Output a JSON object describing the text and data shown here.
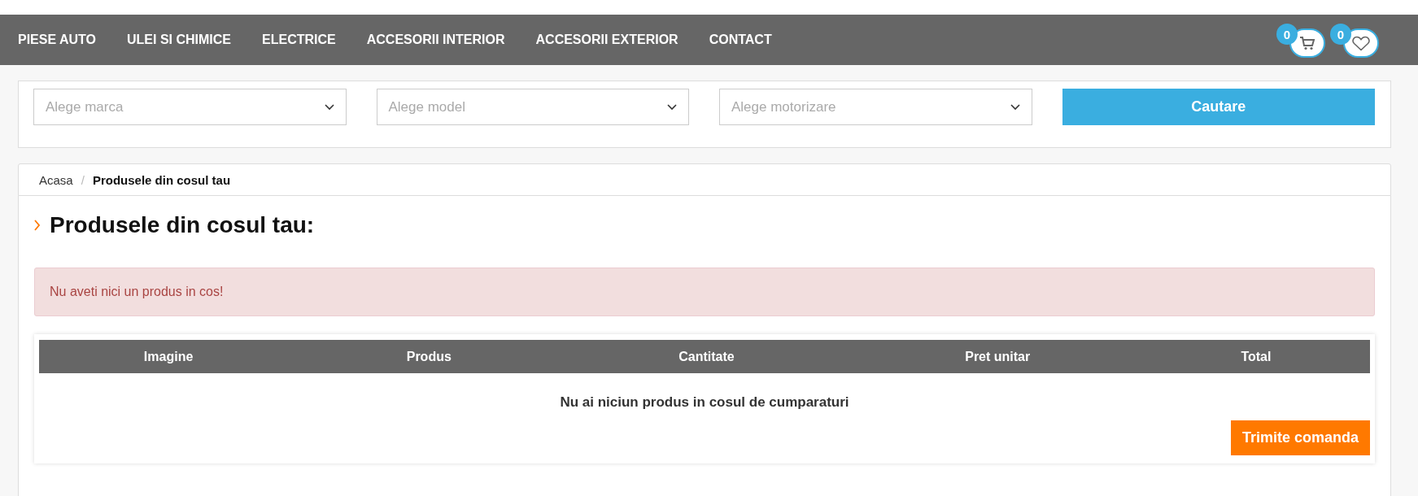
{
  "nav": {
    "items": [
      "PIESE AUTO",
      "ULEI SI CHIMICE",
      "ELECTRICE",
      "ACCESORII INTERIOR",
      "ACCESORII EXTERIOR",
      "CONTACT"
    ],
    "cart_count": "0",
    "wishlist_count": "0"
  },
  "search": {
    "selects": [
      {
        "placeholder": "Alege marca"
      },
      {
        "placeholder": "Alege model"
      },
      {
        "placeholder": "Alege motorizare"
      }
    ],
    "button": "Cautare"
  },
  "breadcrumb": {
    "separator": "/",
    "items": [
      {
        "label": "Acasa",
        "current": false
      },
      {
        "label": "Produsele din cosul tau",
        "current": true
      }
    ]
  },
  "page_title": "Produsele din cosul tau:",
  "alert": "Nu aveti nici un produs in cos!",
  "table": {
    "columns": [
      "Imagine",
      "Produs",
      "Cantitate",
      "Pret unitar",
      "Total"
    ],
    "empty_message": "Nu ai niciun produs in cosul de cumparaturi",
    "submit_button": "Trimite comanda"
  }
}
